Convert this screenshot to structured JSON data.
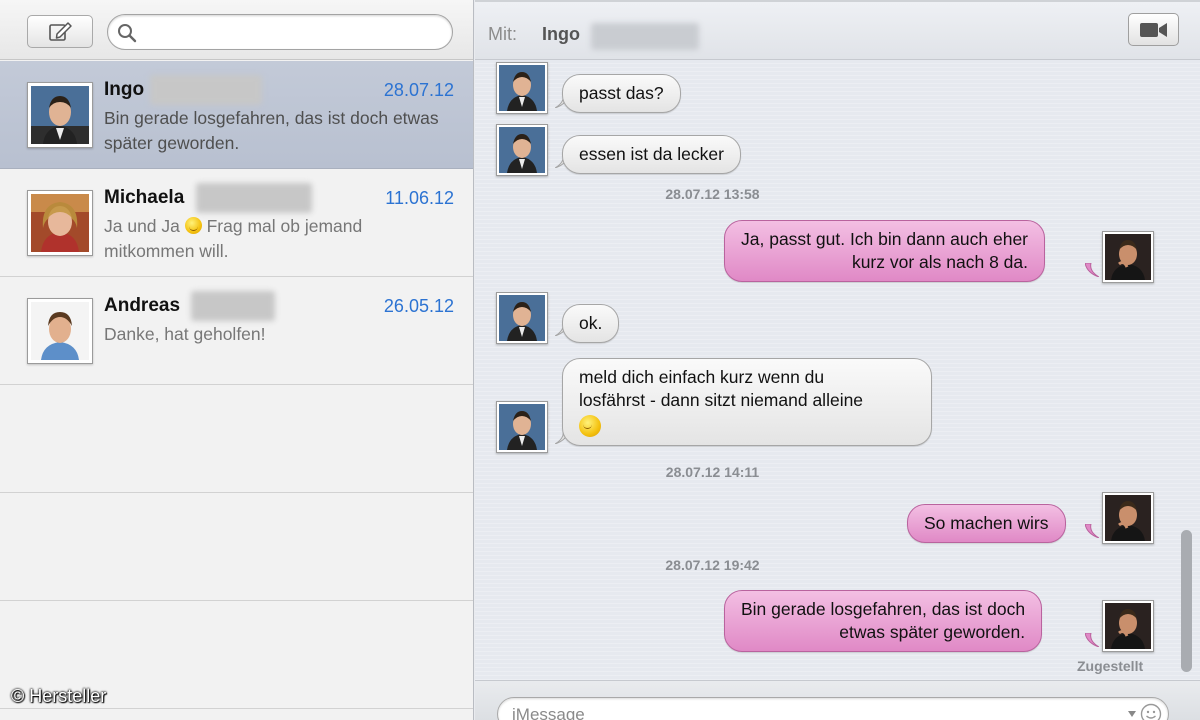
{
  "sidebar": {
    "search": {
      "placeholder": "",
      "value": ""
    },
    "conversations": [
      {
        "name": "Ingo",
        "date": "28.07.12",
        "preview": "Bin gerade losgefahren, das ist doch etwas später geworden.",
        "selected": true
      },
      {
        "name": "Michaela",
        "date": "11.06.12",
        "preview_before_emoji": "Ja und Ja ",
        "preview_after_emoji": " Frag mal ob jemand mitkommen will.",
        "selected": false
      },
      {
        "name": "Andreas",
        "date": "26.05.12",
        "preview": "Danke, hat geholfen!",
        "selected": false
      }
    ]
  },
  "chat": {
    "header": {
      "to_label": "Mit:",
      "recipient": "Ingo"
    },
    "messages": [
      {
        "direction": "in",
        "text": "passt das?"
      },
      {
        "direction": "in",
        "text": "essen ist da lecker"
      },
      {
        "type": "timestamp",
        "text": "28.07.12 13:58"
      },
      {
        "direction": "out",
        "line1": "Ja, passt gut. Ich bin dann auch eher",
        "line2": "kurz vor als nach 8 da."
      },
      {
        "direction": "in",
        "text": "ok."
      },
      {
        "direction": "in",
        "line1": "meld dich einfach kurz wenn du",
        "line2": "losfährst - dann sitzt niemand alleine",
        "has_emoji": true
      },
      {
        "type": "timestamp",
        "text": "28.07.12 14:11"
      },
      {
        "direction": "out",
        "text": "So machen wirs"
      },
      {
        "type": "timestamp",
        "text": "28.07.12 19:42"
      },
      {
        "direction": "out",
        "line1": "Bin gerade losgefahren, das ist doch",
        "line2": "etwas später geworden."
      }
    ],
    "delivery_status": "Zugestellt",
    "input": {
      "placeholder": "iMessage"
    }
  },
  "watermark": "© Hersteller",
  "colors": {
    "selected_row": "#bfc6d5",
    "date_blue": "#2c73d2",
    "outgoing_bubble": "#e9a3d4",
    "incoming_bubble": "#f0f0f0"
  },
  "icons": [
    "compose-icon",
    "search-icon",
    "video-camera-icon",
    "emoji-picker-icon",
    "dropdown-arrow-icon"
  ]
}
